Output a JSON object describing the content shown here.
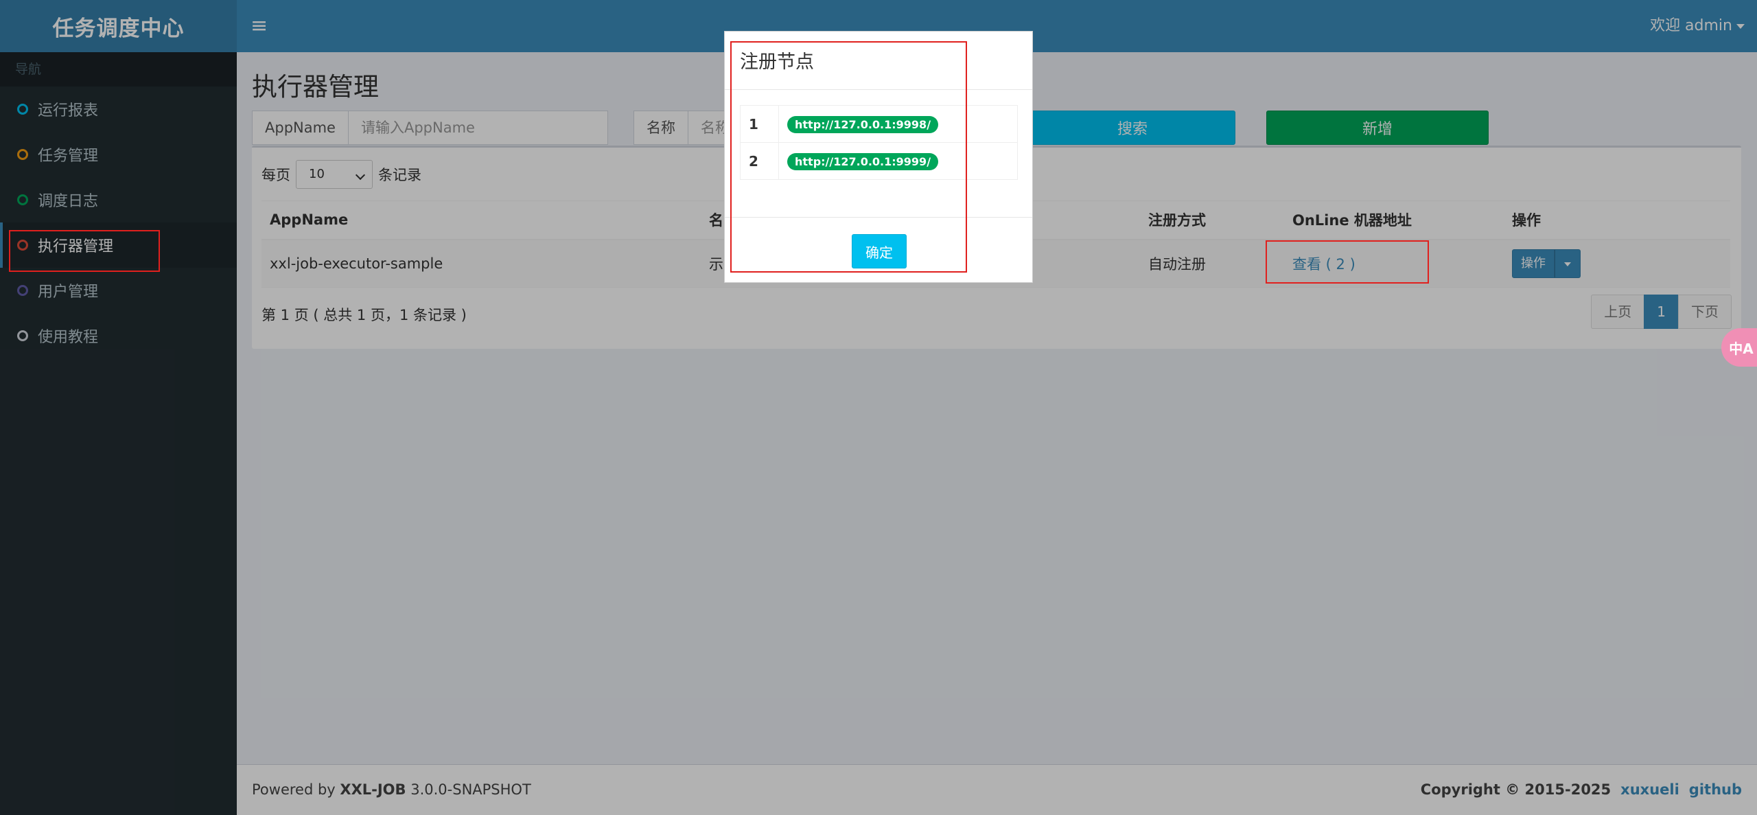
{
  "brand": {
    "title": "任务调度中心"
  },
  "sidebar": {
    "header": "导航",
    "items": [
      {
        "label": "运行报表",
        "color": "#00c0ef"
      },
      {
        "label": "任务管理",
        "color": "#f39c12"
      },
      {
        "label": "调度日志",
        "color": "#00a65a"
      },
      {
        "label": "执行器管理",
        "color": "#dd4b39"
      },
      {
        "label": "用户管理",
        "color": "#605ca8"
      },
      {
        "label": "使用教程",
        "color": "#d2d6de"
      }
    ]
  },
  "header": {
    "menu_icon": "≡",
    "user_label": "欢迎 admin"
  },
  "main": {
    "title": "执行器管理",
    "filters": {
      "appname_label": "AppName",
      "appname_placeholder": "请输入AppName",
      "name_label": "名称",
      "name_placeholder": "名称"
    },
    "search_label": "搜索",
    "add_label": "新增",
    "per_page_prefix": "每页",
    "per_page_value": "10",
    "per_page_suffix": "条记录",
    "table": {
      "headers": [
        "AppName",
        "名",
        "注册方式",
        "OnLine 机器地址",
        "操作"
      ],
      "rows": [
        {
          "appname": "xxl-job-executor-sample",
          "name": "示",
          "reg_type": "自动注册",
          "online": "查看 ( 2 )",
          "op": "操作"
        }
      ]
    },
    "page_info": "第 1 页 ( 总共 1 页，1 条记录 )",
    "pager": {
      "prev": "上页",
      "current": "1",
      "next": "下页"
    }
  },
  "footer": {
    "powered_prefix": "Powered by ",
    "powered_brand": "XXL-JOB",
    "powered_version": " 3.0.0-SNAPSHOT",
    "copyright": "Copyright © 2015-2025",
    "link1": "xuxueli",
    "link2": "github"
  },
  "modal": {
    "title": "注册节点",
    "nodes": [
      {
        "index": "1",
        "url": "http://127.0.0.1:9998/"
      },
      {
        "index": "2",
        "url": "http://127.0.0.1:9999/"
      }
    ],
    "ok_label": "确定"
  },
  "translate_button": {
    "label": "中A"
  }
}
